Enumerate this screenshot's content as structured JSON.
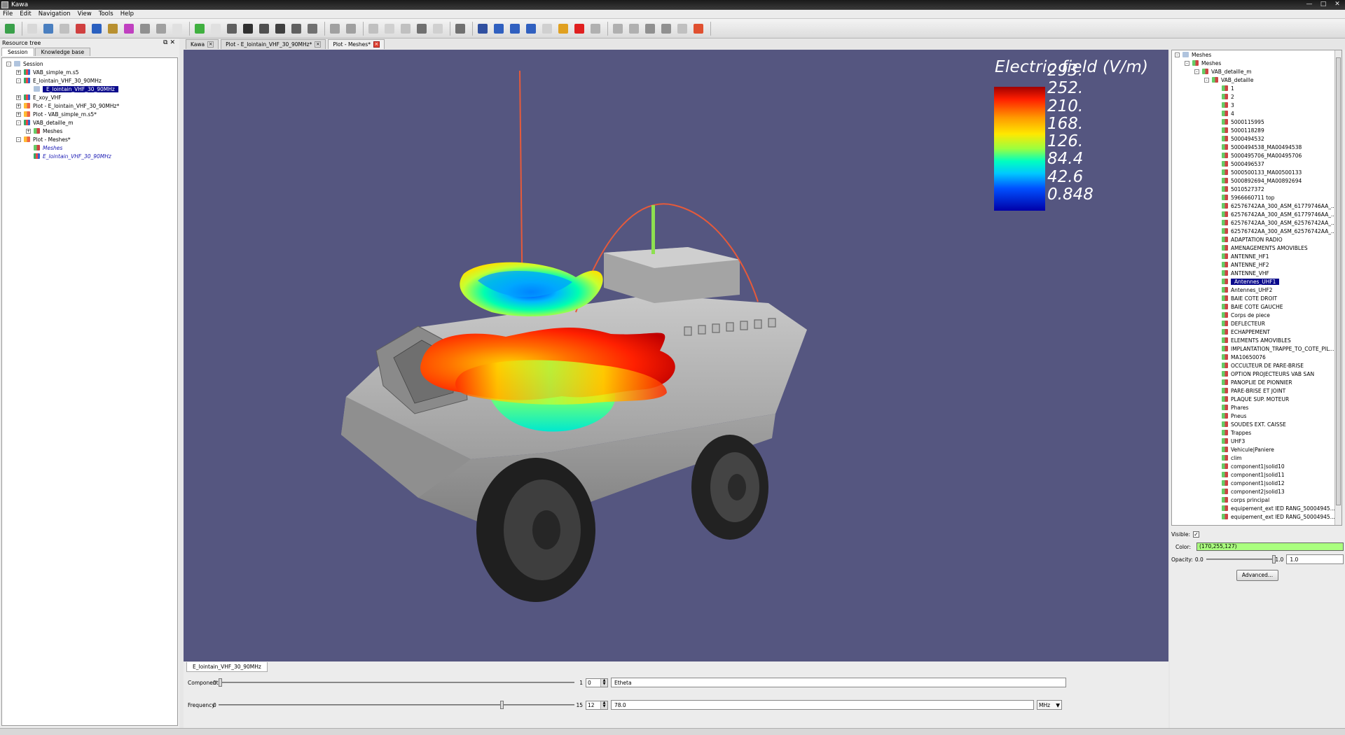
{
  "window": {
    "title": "Kawa"
  },
  "menu": [
    "File",
    "Edit",
    "Navigation",
    "View",
    "Tools",
    "Help"
  ],
  "toolbar_icons": [
    "new-icon",
    "open-icon",
    "import-mesh-icon",
    "image-icon",
    "pdf-icon",
    "chart-icon",
    "edit-icon",
    "plot-icon",
    "database-icon",
    "cylinder-icon",
    "page-icon",
    "download-icon",
    "export-icon",
    "delete-icon",
    "save-icon",
    "save-as-icon",
    "save-all-icon",
    "save-copy-icon",
    "export-doc-icon",
    "undo-icon",
    "redo-icon",
    "pointer-icon",
    "copy-icon",
    "paste-icon",
    "stop-icon",
    "cut-icon",
    "home-view-icon",
    "measure-icon",
    "zoom-in-icon",
    "zoom-fit-icon",
    "zoom-out-icon",
    "frame-icon",
    "binoculars-icon",
    "close-red-icon",
    "layers-icon",
    "move-icon",
    "up-icon",
    "minus-icon",
    "down-icon",
    "star-icon",
    "help-lifebuoy-icon"
  ],
  "left_panel": {
    "title": "Resource tree",
    "tabs": [
      "Session",
      "Knowledge base"
    ],
    "tree": [
      {
        "label": "Session",
        "level": 0,
        "icon": "session",
        "expander": "-"
      },
      {
        "label": "VAB_simple_m.s5",
        "level": 1,
        "icon": "chart",
        "expander": "+"
      },
      {
        "label": "E_lointain_VHF_30_90MHz",
        "level": 1,
        "icon": "chart",
        "expander": "-"
      },
      {
        "label": "E_lointain_VHF_30_90MHz",
        "level": 2,
        "icon": "session",
        "expander": "",
        "selected": true
      },
      {
        "label": "E_xoy_VHF",
        "level": 1,
        "icon": "chart",
        "expander": "+"
      },
      {
        "label": "Plot - E_lointain_VHF_30_90MHz*",
        "level": 1,
        "icon": "plot",
        "expander": "+"
      },
      {
        "label": "Plot - VAB_simple_m.s5*",
        "level": 1,
        "icon": "plot",
        "expander": "+"
      },
      {
        "label": "VAB_detaille_m",
        "level": 1,
        "icon": "chart",
        "expander": "-"
      },
      {
        "label": "Meshes",
        "level": 2,
        "icon": "mesh",
        "expander": "+"
      },
      {
        "label": "Plot - Meshes*",
        "level": 1,
        "icon": "plot",
        "expander": "-"
      },
      {
        "label": "Meshes",
        "level": 2,
        "icon": "mesh",
        "expander": "",
        "italic": true
      },
      {
        "label": "E_lointain_VHF_30_90MHz",
        "level": 2,
        "icon": "chart",
        "expander": "",
        "italic": true
      }
    ]
  },
  "doc_tabs": [
    {
      "label": "Kawa",
      "close": "grey"
    },
    {
      "label": "Plot - E_lointain_VHF_30_90MHz*",
      "close": "grey"
    },
    {
      "label": "Plot - Meshes*",
      "close": "red",
      "active": true
    }
  ],
  "legend": {
    "title": "Electric field (V/m)",
    "labels": [
      "293.",
      "252.",
      "210.",
      "168.",
      "126.",
      "84.4",
      "42.6",
      "0.848"
    ]
  },
  "bottom": {
    "tab": "E_lointain_VHF_30_90MHz",
    "component": {
      "label": "Component",
      "min": "0",
      "max": "1",
      "spin": "0",
      "value_fraction": 0.0,
      "text": "Etheta"
    },
    "frequency": {
      "label": "Frequency",
      "min": "0",
      "max": "15",
      "spin": "12",
      "value_fraction": 0.8,
      "text": "78.0",
      "unit": "MHz"
    }
  },
  "right_panel": {
    "tree": [
      {
        "label": "Meshes",
        "level": 0,
        "expander": "-",
        "icon": "session"
      },
      {
        "label": "Meshes",
        "level": 1,
        "expander": "-",
        "icon": "mesh"
      },
      {
        "label": "VAB_detaille_m",
        "level": 2,
        "expander": "-",
        "icon": "mesh"
      },
      {
        "label": "VAB_detaille",
        "level": 3,
        "expander": "-",
        "icon": "mesh"
      },
      {
        "label": "1",
        "level": 4,
        "icon": "mesh"
      },
      {
        "label": "2",
        "level": 4,
        "icon": "mesh"
      },
      {
        "label": "3",
        "level": 4,
        "icon": "mesh"
      },
      {
        "label": "4",
        "level": 4,
        "icon": "mesh"
      },
      {
        "label": "5000115995",
        "level": 4,
        "icon": "mesh"
      },
      {
        "label": "5000118289",
        "level": 4,
        "icon": "mesh"
      },
      {
        "label": "5000494532",
        "level": 4,
        "icon": "mesh"
      },
      {
        "label": "5000494538_MA00494538",
        "level": 4,
        "icon": "mesh"
      },
      {
        "label": "5000495706_MA00495706",
        "level": 4,
        "icon": "mesh"
      },
      {
        "label": "5000496537",
        "level": 4,
        "icon": "mesh"
      },
      {
        "label": "5000500133_MA00500133",
        "level": 4,
        "icon": "mesh"
      },
      {
        "label": "5000892694_MA00892694",
        "level": 4,
        "icon": "mesh"
      },
      {
        "label": "5010527372",
        "level": 4,
        "icon": "mesh"
      },
      {
        "label": "5966660711 top",
        "level": 4,
        "icon": "mesh"
      },
      {
        "label": "62576742AA_300_ASM_61779746AA_...",
        "level": 4,
        "icon": "mesh"
      },
      {
        "label": "62576742AA_300_ASM_61779746AA_...",
        "level": 4,
        "icon": "mesh"
      },
      {
        "label": "62576742AA_300_ASM_62576742AA_...",
        "level": 4,
        "icon": "mesh"
      },
      {
        "label": "62576742AA_300_ASM_62576742AA_...",
        "level": 4,
        "icon": "mesh"
      },
      {
        "label": "ADAPTATION RADIO",
        "level": 4,
        "icon": "mesh"
      },
      {
        "label": "AMENAGEMENTS AMOVIBLES",
        "level": 4,
        "icon": "mesh"
      },
      {
        "label": "ANTENNE_HF1",
        "level": 4,
        "icon": "mesh"
      },
      {
        "label": "ANTENNE_HF2",
        "level": 4,
        "icon": "mesh"
      },
      {
        "label": "ANTENNE_VHF",
        "level": 4,
        "icon": "mesh"
      },
      {
        "label": "Antennes_UHF1",
        "level": 4,
        "icon": "mesh",
        "selected": true
      },
      {
        "label": "Antennes_UHF2",
        "level": 4,
        "icon": "mesh"
      },
      {
        "label": "BAIE COTE DROIT",
        "level": 4,
        "icon": "mesh"
      },
      {
        "label": "BAIE COTE GAUCHE",
        "level": 4,
        "icon": "mesh"
      },
      {
        "label": "Corps de piece",
        "level": 4,
        "icon": "mesh"
      },
      {
        "label": "DEFLECTEUR",
        "level": 4,
        "icon": "mesh"
      },
      {
        "label": "ECHAPPEMENT",
        "level": 4,
        "icon": "mesh"
      },
      {
        "label": "ELEMENTS AMOVIBLES",
        "level": 4,
        "icon": "mesh"
      },
      {
        "label": "IMPLANTATION_TRAPPE_TO_COTE_PIL...",
        "level": 4,
        "icon": "mesh"
      },
      {
        "label": "MA10650076",
        "level": 4,
        "icon": "mesh"
      },
      {
        "label": "OCCULTEUR DE PARE-BRISE",
        "level": 4,
        "icon": "mesh"
      },
      {
        "label": "OPTION PROJECTEURS VAB SAN",
        "level": 4,
        "icon": "mesh"
      },
      {
        "label": "PANOPLIE DE PIONNIER",
        "level": 4,
        "icon": "mesh"
      },
      {
        "label": "PARE-BRISE ET JOINT",
        "level": 4,
        "icon": "mesh"
      },
      {
        "label": "PLAQUE SUP. MOTEUR",
        "level": 4,
        "icon": "mesh"
      },
      {
        "label": "Phares",
        "level": 4,
        "icon": "mesh"
      },
      {
        "label": "Pneus",
        "level": 4,
        "icon": "mesh"
      },
      {
        "label": "SOUDES EXT. CAISSE",
        "level": 4,
        "icon": "mesh"
      },
      {
        "label": "Trappes",
        "level": 4,
        "icon": "mesh"
      },
      {
        "label": "UHF3",
        "level": 4,
        "icon": "mesh"
      },
      {
        "label": "Vehicule|Paniere",
        "level": 4,
        "icon": "mesh"
      },
      {
        "label": "clim",
        "level": 4,
        "icon": "mesh"
      },
      {
        "label": "component1|solid10",
        "level": 4,
        "icon": "mesh"
      },
      {
        "label": "component1|solid11",
        "level": 4,
        "icon": "mesh"
      },
      {
        "label": "component1|solid12",
        "level": 4,
        "icon": "mesh"
      },
      {
        "label": "component2|solid13",
        "level": 4,
        "icon": "mesh"
      },
      {
        "label": "corps principal",
        "level": 4,
        "icon": "mesh"
      },
      {
        "label": "equipement_ext IED RANG_50004945...",
        "level": 4,
        "icon": "mesh"
      },
      {
        "label": "equipement_ext IED RANG_50004945...",
        "level": 4,
        "icon": "mesh"
      }
    ],
    "props": {
      "visible_label": "Visible:",
      "visible_checked": "✓",
      "color_label": "Color:",
      "color_value": "(170,255,127)",
      "opacity_label": "Opacity:",
      "opacity_min": "0.0",
      "opacity_max": "1.0",
      "opacity_value": "1.0",
      "opacity_fraction": 1.0,
      "advanced_label": "Advanced..."
    }
  },
  "colors": {
    "viewport_bg": "#555680",
    "selection": "#0a0a8c",
    "mesh_color": "#aaff7f"
  }
}
